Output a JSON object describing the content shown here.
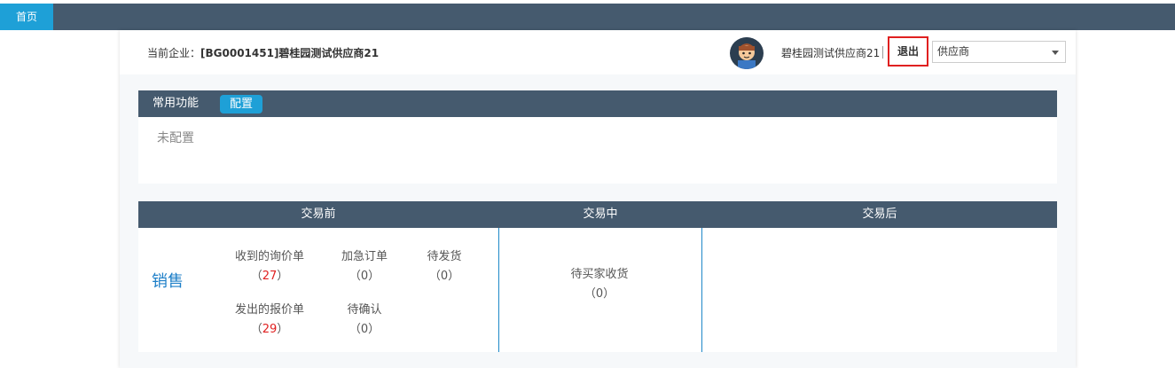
{
  "nav": {
    "home_tab": "首页"
  },
  "header": {
    "company_label": "当前企业：",
    "company_name": "[BG0001451]碧桂园测试供应商21",
    "user_name": "碧桂园测试供应商21",
    "logout_label": "退出",
    "role_selected": "供应商"
  },
  "common_functions": {
    "title": "常用功能",
    "config_button": "配置",
    "empty_text": "未配置"
  },
  "trade": {
    "columns": [
      "交易前",
      "交易中",
      "交易后"
    ],
    "row_label": "销售",
    "before": [
      {
        "label": "收到的询价单",
        "open": "（",
        "value": "27",
        "close": "）"
      },
      {
        "label": "加急订单",
        "open": "（",
        "value": "0",
        "close": "）"
      },
      {
        "label": "待发货",
        "open": "（",
        "value": "0",
        "close": "）"
      },
      {
        "label": "发出的报价单",
        "open": "（",
        "value": "29",
        "close": "）"
      },
      {
        "label": "待确认",
        "open": "（",
        "value": "0",
        "close": "）"
      }
    ],
    "during": [
      {
        "label": "待买家收货",
        "open": "（",
        "value": "0",
        "close": "）"
      }
    ]
  },
  "colors": {
    "nav_bg": "#455a6e",
    "accent": "#1ea0d7",
    "highlight_number": "#e02020",
    "link_blue": "#1e7fc8"
  }
}
